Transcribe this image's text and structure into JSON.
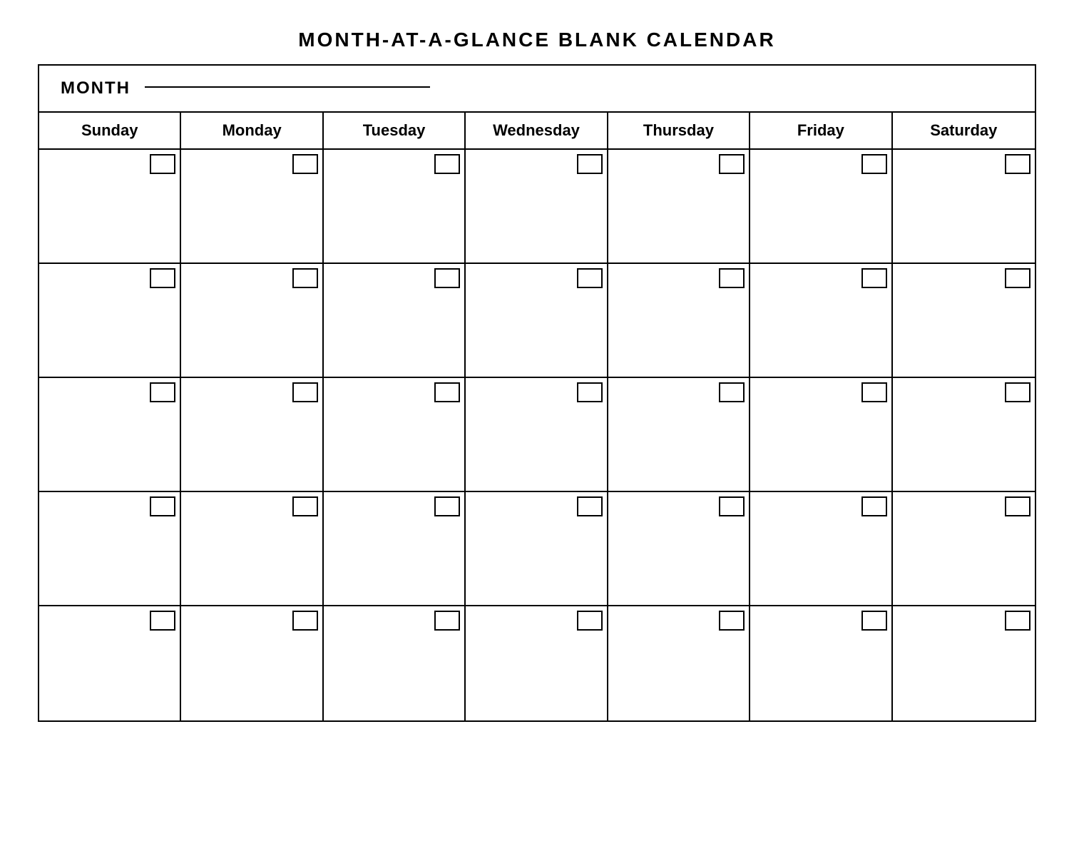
{
  "title": "MONTH-AT-A-GLANCE  BLANK  CALENDAR",
  "month_label": "MONTH",
  "days": [
    "Sunday",
    "Monday",
    "Tuesday",
    "Wednesday",
    "Thursday",
    "Friday",
    "Saturday"
  ],
  "rows": 5,
  "cols": 7
}
